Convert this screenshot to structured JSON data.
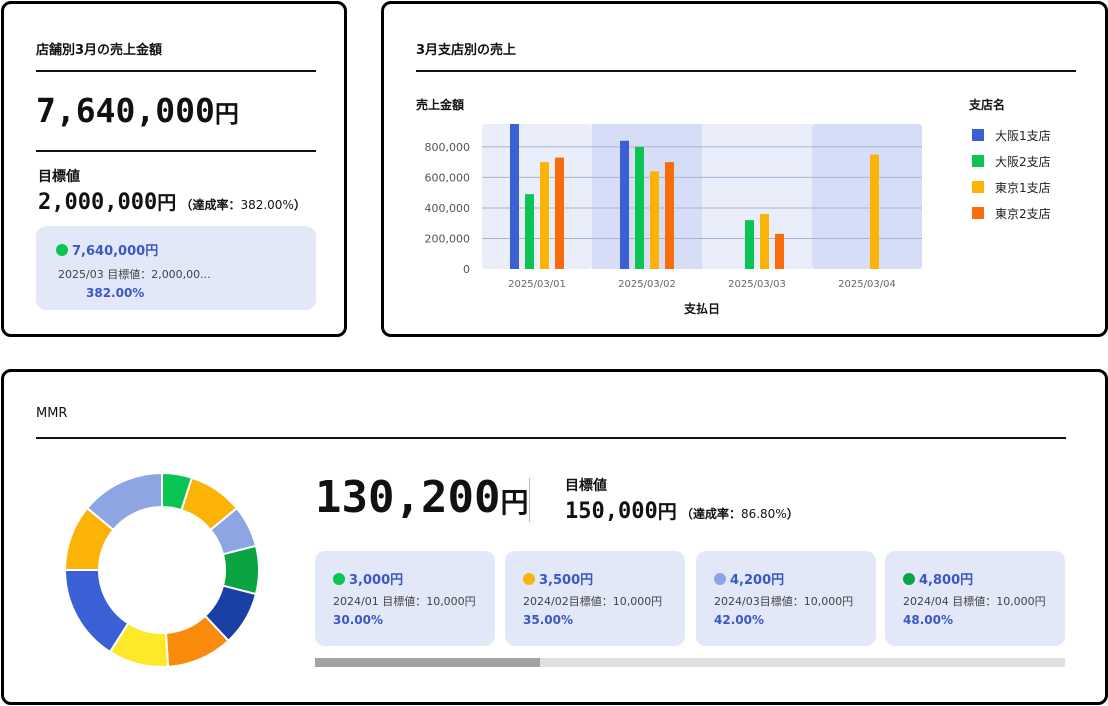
{
  "store_card": {
    "title": "店舗別3月の売上金額",
    "amount": "7,640,000",
    "unit": "円",
    "target_label": "目標値",
    "target_amount": "2,000,000",
    "target_unit": "円",
    "rate_open": "（",
    "rate_label": "達成率：",
    "rate_value": "382.00%",
    "rate_close": "）",
    "mini": {
      "value": "7,640,000円",
      "sub": "2025/03 目標値：2,000,00...",
      "pct": "382.00%",
      "dot_color": "#0ac554"
    }
  },
  "branch_card": {
    "title": "3月支店別の売上",
    "chart_data": {
      "type": "bar",
      "ylabel": "売上金額",
      "xlabel": "支払日",
      "ylim": [
        0,
        950000
      ],
      "yticks": [
        0,
        200000,
        400000,
        600000,
        800000
      ],
      "ytick_labels": [
        "0",
        "200,000",
        "400,000",
        "600,000",
        "800,000"
      ],
      "categories": [
        "2025/03/01",
        "2025/03/02",
        "2025/03/03",
        "2025/03/04"
      ],
      "legend_title": "支店名",
      "legend_position": "right",
      "series": [
        {
          "name": "大阪1支店",
          "color": "#3b5fd4",
          "values": [
            950000,
            840000,
            0,
            0
          ]
        },
        {
          "name": "大阪2支店",
          "color": "#0ac554",
          "values": [
            490000,
            800000,
            320000,
            0
          ]
        },
        {
          "name": "東京1支店",
          "color": "#fbb308",
          "values": [
            700000,
            640000,
            360000,
            750000
          ]
        },
        {
          "name": "東京2支店",
          "color": "#f96c0b",
          "values": [
            730000,
            700000,
            230000,
            0
          ]
        }
      ]
    }
  },
  "mmr_card": {
    "title": "MMR",
    "amount": "130,200",
    "unit": "円",
    "target_label": "目標値",
    "target_amount": "150,000",
    "target_unit": "円",
    "rate_open": "（",
    "rate_label": "達成率：",
    "rate_value": "86.80%",
    "rate_close": "）",
    "progress": 0.3,
    "donut": {
      "segments": [
        {
          "value": 5,
          "color": "#0ac554"
        },
        {
          "value": 9,
          "color": "#fbb308"
        },
        {
          "value": 7,
          "color": "#8ea5e4"
        },
        {
          "value": 8,
          "color": "#0aa542"
        },
        {
          "value": 9,
          "color": "#1a40a6"
        },
        {
          "value": 11,
          "color": "#fa8a0b"
        },
        {
          "value": 10,
          "color": "#fde92a"
        },
        {
          "value": 16,
          "color": "#3b5fd4"
        },
        {
          "value": 11,
          "color": "#fbb308"
        },
        {
          "value": 14,
          "color": "#8ea5e4"
        }
      ]
    },
    "months": [
      {
        "value": "3,000円",
        "sub": "2024/01 目標値：10,000円",
        "pct": "30.00%",
        "dot_color": "#0ac554"
      },
      {
        "value": "3,500円",
        "sub": "2024/02目標値：10,000円",
        "pct": "35.00%",
        "dot_color": "#fbb308"
      },
      {
        "value": "4,200円",
        "sub": "2024/03目標値：10,000円",
        "pct": "42.00%",
        "dot_color": "#8ea5e4"
      },
      {
        "value": "4,800円",
        "sub": "2024/04 目標値：10,000円",
        "pct": "48.00%",
        "dot_color": "#0aa542"
      }
    ]
  }
}
